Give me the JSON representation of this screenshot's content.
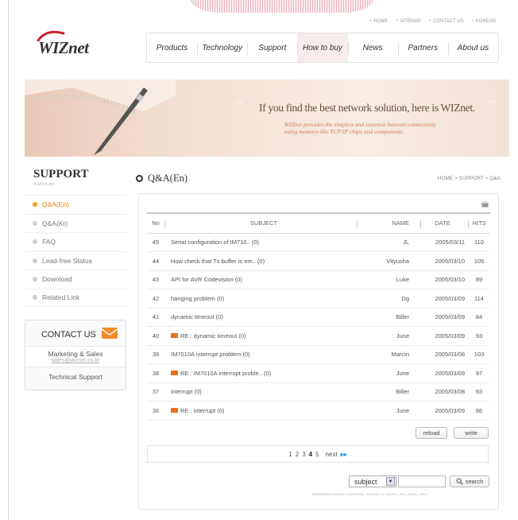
{
  "utility_links": [
    "HOME",
    "SITEMAP",
    "CONTACT US",
    "KOREAN"
  ],
  "logo": {
    "text": "WIZnet"
  },
  "gnb": [
    {
      "label": "Products",
      "active": false
    },
    {
      "label": "Technology",
      "active": false
    },
    {
      "label": "Support",
      "active": false
    },
    {
      "label": "How to buy",
      "active": true
    },
    {
      "label": "News",
      "active": false
    },
    {
      "label": "Partners",
      "active": false
    },
    {
      "label": "About us",
      "active": false
    }
  ],
  "banner": {
    "headline": "If you find the best network solution, here is WIZnet.",
    "sub_line1": "WIZnet provides the simplest and smartest Internet connectivity",
    "sub_line2": "using memory-like TCP/IP chips and components."
  },
  "sidebar": {
    "title": "SUPPORT",
    "subtitle": "WIZnet.Inc.",
    "items": [
      {
        "label": "Q&A(En)",
        "active": true
      },
      {
        "label": "Q&A(Kr)",
        "active": false
      },
      {
        "label": "FAQ",
        "active": false
      },
      {
        "label": "Lead-free Status",
        "active": false
      },
      {
        "label": "Download",
        "active": false
      },
      {
        "label": "Related Link",
        "active": false
      }
    ]
  },
  "contact": {
    "title": "CONTACT US",
    "marketing_label": "Marketing & Sales",
    "marketing_email": "sales@wiznet.co.kr",
    "tech_label": "Technical Support"
  },
  "page": {
    "title": "Q&A(En)",
    "breadcrumb": "HOME > SUPPORT > Q&A"
  },
  "board": {
    "columns": {
      "no": "No",
      "subject": "SUBJECT",
      "name": "NAME",
      "date": "DATE",
      "hits": "HITS"
    },
    "rows": [
      {
        "no": "45",
        "subject": "Serial configuration of IM710.. (0)",
        "name": "JL",
        "date": "2005/03/11",
        "hits": "110",
        "reply": false
      },
      {
        "no": "44",
        "subject": "How check that Tx buffer is em.. (0)",
        "name": "Vityusha",
        "date": "2005/03/10",
        "hits": "105",
        "reply": false
      },
      {
        "no": "43",
        "subject": "API for AVR Codevision (0)",
        "name": "Luke",
        "date": "2005/03/10",
        "hits": "89",
        "reply": false
      },
      {
        "no": "42",
        "subject": "hanging problem (0)",
        "name": "Dg",
        "date": "2005/03/09",
        "hits": "114",
        "reply": false
      },
      {
        "no": "41",
        "subject": "dynamic timeout (0)",
        "name": "Biller",
        "date": "2005/03/09",
        "hits": "84",
        "reply": false
      },
      {
        "no": "40",
        "subject": "RE : dynamic timeout (0)",
        "name": "June",
        "date": "2005/03/09",
        "hits": "93",
        "reply": true
      },
      {
        "no": "39",
        "subject": "IM7010A interrupt problem (0)",
        "name": "Marcin",
        "date": "2005/03/08",
        "hits": "103",
        "reply": false
      },
      {
        "no": "38",
        "subject": "RE : IM7010A interrupt proble.. (0)",
        "name": "June",
        "date": "2005/03/09",
        "hits": "97",
        "reply": true
      },
      {
        "no": "37",
        "subject": "interrupt (0)",
        "name": "Biller",
        "date": "2005/03/08",
        "hits": "93",
        "reply": false
      },
      {
        "no": "36",
        "subject": "RE : interrupt (0)",
        "name": "June",
        "date": "2005/03/09",
        "hits": "86",
        "reply": true
      }
    ],
    "reload_label": "reload",
    "write_label": "write"
  },
  "pager": {
    "pages": [
      "1",
      "2",
      "3",
      "4",
      "5"
    ],
    "current": "4",
    "next_label": "next",
    "next_icon": "▸▸"
  },
  "search": {
    "field_selected": "subject",
    "button_label": "search",
    "footer_note": "WEBKOREN BOARD (VERSION) ,SKIN BY LX_BASIC, IMG_BASIC_ENG"
  },
  "colors": {
    "accent_orange": "#e8820c",
    "reply_badge": "#e8701a",
    "logo_red": "#c8202c"
  }
}
